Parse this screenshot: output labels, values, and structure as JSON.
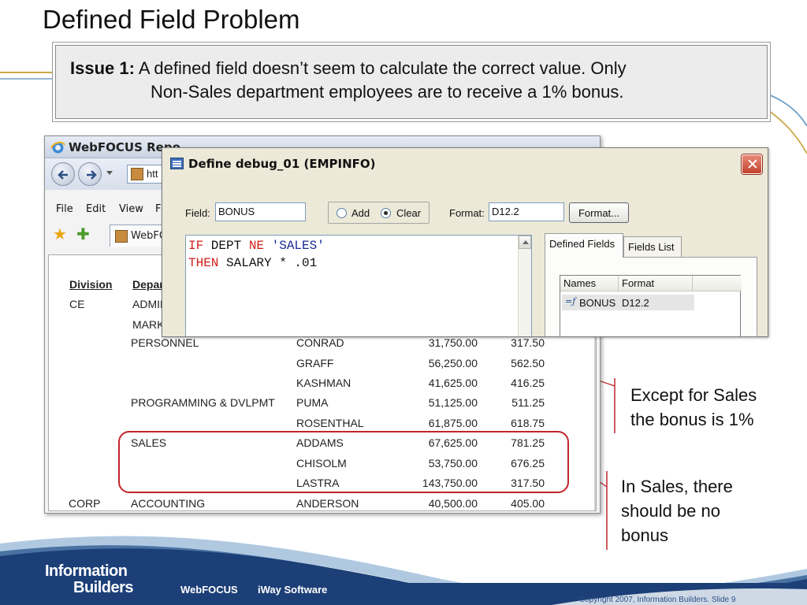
{
  "slide": {
    "title": "Defined Field Problem",
    "issue_label": "Issue 1:",
    "issue_line1": "A defined field doesn’t seem to calculate the correct value. Only",
    "issue_line2": "Non-Sales department employees are to receive a 1% bonus."
  },
  "browser": {
    "title": "WebFOCUS Repo",
    "address_text": "htt",
    "menu": [
      "File",
      "Edit",
      "View",
      "F"
    ],
    "tab_label": "WebFO",
    "icons": {
      "back": "back-arrow-icon",
      "forward": "forward-arrow-icon",
      "favorites": "star-icon",
      "add_favorite": "add-favorite-icon"
    }
  },
  "report": {
    "headers": {
      "division": "Division",
      "department": "Depar"
    },
    "rows": [
      {
        "division": "CE",
        "department": "ADMIN",
        "name": "",
        "salary": "",
        "bonus": ""
      },
      {
        "division": "",
        "department": "MARK",
        "name": "",
        "salary": "",
        "bonus": ""
      },
      {
        "division": "",
        "department": "PERSONNEL",
        "name": "CONRAD",
        "salary": "31,750.00",
        "bonus": "317.50"
      },
      {
        "division": "",
        "department": "",
        "name": "GRAFF",
        "salary": "56,250.00",
        "bonus": "562.50"
      },
      {
        "division": "",
        "department": "",
        "name": "KASHMAN",
        "salary": "41,625.00",
        "bonus": "416.25"
      },
      {
        "division": "",
        "department": "PROGRAMMING & DVLPMT",
        "name": "PUMA",
        "salary": "51,125.00",
        "bonus": "511.25"
      },
      {
        "division": "",
        "department": "",
        "name": "ROSENTHAL",
        "salary": "61,875.00",
        "bonus": "618.75"
      },
      {
        "division": "",
        "department": "SALES",
        "name": "ADDAMS",
        "salary": "67,625.00",
        "bonus": "781.25"
      },
      {
        "division": "",
        "department": "",
        "name": "CHISOLM",
        "salary": "53,750.00",
        "bonus": "676.25"
      },
      {
        "division": "",
        "department": "",
        "name": "LASTRA",
        "salary": "143,750.00",
        "bonus": "317.50"
      },
      {
        "division": "CORP",
        "department": "ACCOUNTING",
        "name": "ANDERSON",
        "salary": "40,500.00",
        "bonus": "405.00"
      }
    ]
  },
  "dialog": {
    "title": "Define debug_01 (EMPINFO)",
    "field_label": "Field:",
    "field_value": "BONUS",
    "radio_add": "Add",
    "radio_clear": "Clear",
    "radio_selected": "Clear",
    "format_label": "Format:",
    "format_value": "D12.2",
    "format_button": "Format...",
    "code": {
      "l1_kw1": "IF",
      "l1_mid": " DEPT ",
      "l1_kw2": "NE",
      "l1_sp": " ",
      "l1_str": "'SALES'",
      "l2_kw": "THEN",
      "l2_rest": " SALARY * .01"
    },
    "tabs": [
      "Defined Fields",
      "Fields List"
    ],
    "active_tab": "Defined Fields",
    "list_headers": [
      "Names",
      "Format"
    ],
    "list_rows": [
      {
        "name": "BONUS",
        "format": "D12.2"
      }
    ],
    "colors": {
      "keyword": "#d2201b",
      "string": "#1d2b9a"
    }
  },
  "annotations": {
    "except_sales": [
      "Except for Sales",
      "the bonus is 1%"
    ],
    "in_sales": [
      "In Sales, there",
      "should be no",
      "bonus"
    ],
    "accent_color": "#c0262c"
  },
  "footer": {
    "logo_line1": "Information",
    "logo_line2": "Builders",
    "products": [
      "WebFOCUS",
      "iWay Software"
    ],
    "copyright": "Copyright 2007, Information Builders. Slide 9"
  }
}
